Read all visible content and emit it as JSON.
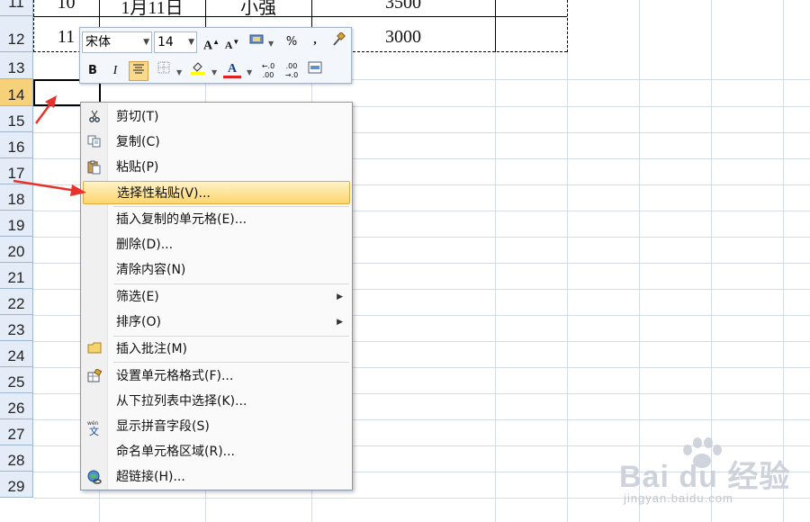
{
  "sheet": {
    "rows": [
      "11",
      "12",
      "13",
      "14",
      "15",
      "16",
      "17",
      "18",
      "19",
      "20",
      "21",
      "22",
      "23",
      "24",
      "25",
      "26",
      "27",
      "28",
      "29"
    ],
    "selected_row": "14",
    "table_rows": [
      {
        "no": "10",
        "date": "1月11日",
        "name": "小强",
        "amount": "3500"
      },
      {
        "no": "11",
        "date": "",
        "name": "",
        "amount": "3000"
      }
    ]
  },
  "mini_toolbar": {
    "font_name": "宋体",
    "font_size": "14",
    "grow_font": "A",
    "shrink_font": "A",
    "percent": "%",
    "comma": ",",
    "bold": "B",
    "italic": "I",
    "font_color_letter": "A",
    "increase_decimal": "←.0 .00",
    "decrease_decimal": ".00 →.0"
  },
  "context_menu": {
    "items": [
      {
        "label": "剪切(T)",
        "icon": "scissors-icon"
      },
      {
        "label": "复制(C)",
        "icon": "copy-icon"
      },
      {
        "label": "粘贴(P)",
        "icon": "paste-icon"
      },
      {
        "label": "选择性粘贴(V)...",
        "icon": ""
      },
      {
        "label": "插入复制的单元格(E)...",
        "icon": ""
      },
      {
        "label": "删除(D)...",
        "icon": ""
      },
      {
        "label": "清除内容(N)",
        "icon": ""
      },
      {
        "label": "筛选(E)",
        "icon": ""
      },
      {
        "label": "排序(O)",
        "icon": ""
      },
      {
        "label": "插入批注(M)",
        "icon": "comment-icon"
      },
      {
        "label": "设置单元格格式(F)...",
        "icon": "format-cells-icon"
      },
      {
        "label": "从下拉列表中选择(K)...",
        "icon": ""
      },
      {
        "label": "显示拼音字段(S)",
        "icon": "phonetic-icon"
      },
      {
        "label": "命名单元格区域(R)...",
        "icon": ""
      },
      {
        "label": "超链接(H)...",
        "icon": "hyperlink-icon"
      }
    ],
    "highlighted_index": 3
  },
  "watermark": {
    "logo": "Bai du 经验",
    "sub": "jingyan.baidu.com"
  },
  "colors": {
    "row_header_bg": "#e4ecf7",
    "selected_row_header": "#f7d07a",
    "highlight_item": "#fcd56d",
    "annotation_arrow": "#e8322d"
  }
}
